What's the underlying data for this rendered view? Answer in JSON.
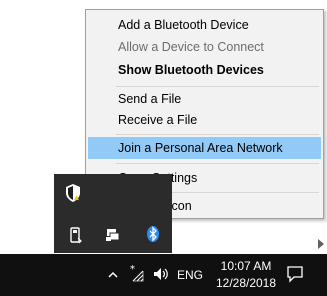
{
  "context_menu": {
    "items": [
      {
        "label": "Add a Bluetooth Device",
        "state": "normal"
      },
      {
        "label": "Allow a Device to Connect",
        "state": "disabled"
      },
      {
        "label": "Show Bluetooth Devices",
        "state": "bold"
      },
      {
        "label": "Send a File",
        "state": "normal"
      },
      {
        "label": "Receive a File",
        "state": "normal"
      },
      {
        "label": "Join a Personal Area Network",
        "state": "highlighted"
      },
      {
        "label": "Open Settings",
        "state": "normal"
      },
      {
        "label": "Remove Icon",
        "state": "normal"
      }
    ]
  },
  "tray_overflow": {
    "icons": [
      "windows-defender-icon",
      "usb-device-icon",
      "display-icon",
      "bluetooth-icon"
    ]
  },
  "taskbar": {
    "language": "ENG",
    "time": "10:07 AM",
    "date": "12/28/2018",
    "icons": [
      "chevron-up-icon",
      "wifi-icon",
      "volume-icon",
      "action-center-icon"
    ]
  },
  "colors": {
    "highlight": "#91c9f7",
    "taskbar": "#101010",
    "tray_panel": "#2b2b2b",
    "bluetooth": "#2b8cf0"
  }
}
